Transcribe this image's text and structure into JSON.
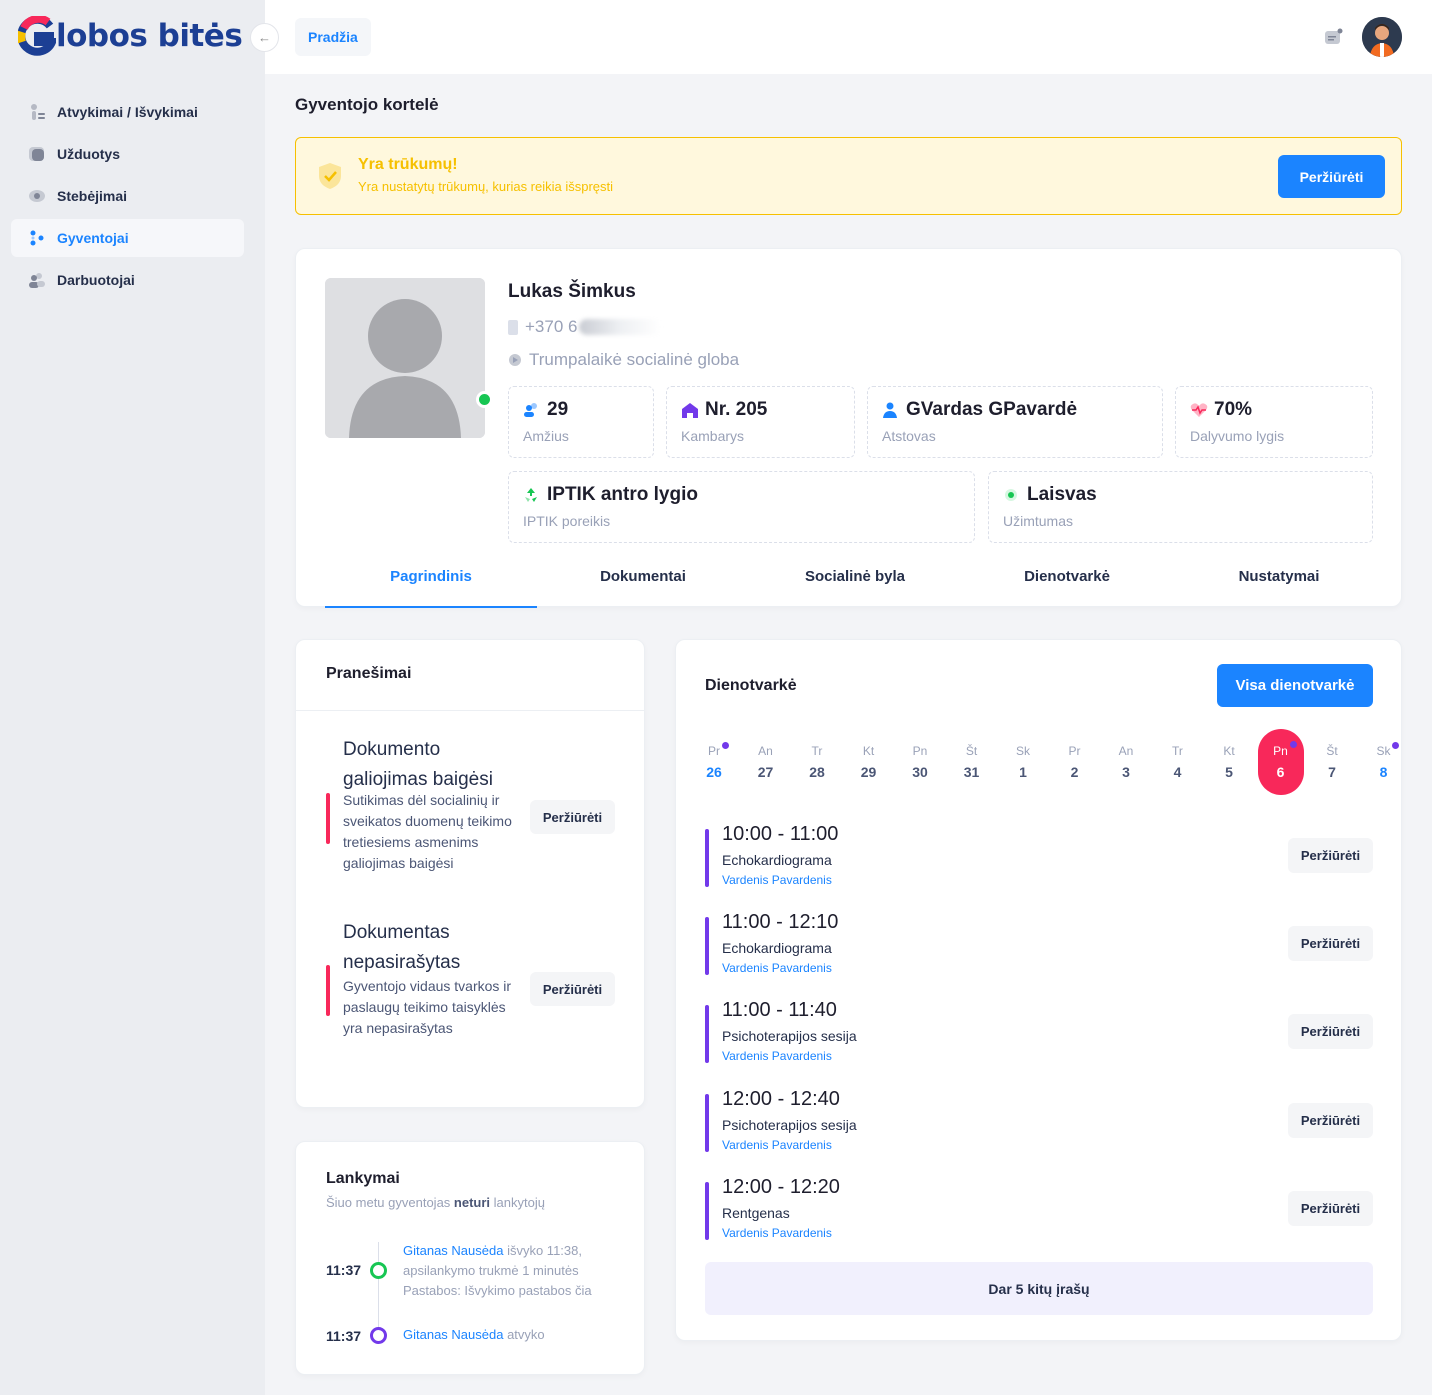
{
  "app": {
    "logo_text": "lobos bitės"
  },
  "sidebar": {
    "items": [
      {
        "label": "Atvykimai / Išvykimai",
        "icon": "person-arrows-icon"
      },
      {
        "label": "Užduotys",
        "icon": "tasks-icon"
      },
      {
        "label": "Stebėjimai",
        "icon": "eye-icon"
      },
      {
        "label": "Gyventojai",
        "icon": "residents-icon",
        "active": true
      },
      {
        "label": "Darbuotojai",
        "icon": "staff-icon"
      }
    ]
  },
  "topbar": {
    "breadcrumb": "Pradžia"
  },
  "page": {
    "title": "Gyventojo kortelė"
  },
  "alert": {
    "title": "Yra trūkumų!",
    "text": "Yra nustatytų trūkumų, kurias reikia išspręsti",
    "button": "Peržiūrėti"
  },
  "profile": {
    "name": "Lukas Šimkus",
    "phone": "+370 6",
    "care_type": "Trumpalaikė socialinė globa",
    "online": true,
    "stats": [
      {
        "value": "29",
        "label": "Amžius",
        "icon": "people-icon",
        "color": "#1b84ff"
      },
      {
        "value": "Nr. 205",
        "label": "Kambarys",
        "icon": "home-icon",
        "color": "#7239ea"
      },
      {
        "value": "GVardas GPavardė",
        "label": "Atstovas",
        "icon": "person-icon",
        "color": "#1b84ff"
      },
      {
        "value": "70%",
        "label": "Dalyvumo lygis",
        "icon": "heart-pulse-icon",
        "color": "#f8285a"
      },
      {
        "value": "IPTIK antro lygio",
        "label": "IPTIK poreikis",
        "icon": "recycle-icon",
        "color": "#17c653"
      },
      {
        "value": "Laisvas",
        "label": "Užimtumas",
        "icon": "status-dot-icon",
        "color": "#17c653"
      }
    ],
    "tabs": [
      "Pagrindinis",
      "Dokumentai",
      "Socialinė byla",
      "Dienotvarkė",
      "Nustatymai"
    ]
  },
  "notifications": {
    "title": "Pranešimai",
    "items": [
      {
        "title": "Dokumento galiojimas baigėsi",
        "text": "Sutikimas dėl socialinių ir sveikatos duomenų teikimo tretiesiems asmenims galiojimas baigėsi",
        "button": "Peržiūrėti"
      },
      {
        "title": "Dokumentas nepasirašytas",
        "text": "Gyventojo vidaus tvarkos ir paslaugų teikimo taisyklės yra nepasirašytas",
        "button": "Peržiūrėti"
      }
    ]
  },
  "visits": {
    "title": "Lankymai",
    "sub_prefix": "Šiuo metu gyventojas",
    "sub_bold": "neturi",
    "sub_suffix": "lankytojų",
    "items": [
      {
        "time": "11:37",
        "person": "Gitanas Nausėda",
        "text": "išvyko 11:38, apsilankymo trukmė 1 minutės",
        "note": "Pastabos: Išvykimo pastabos čia",
        "color": "#17c653"
      },
      {
        "time": "11:37",
        "person": "Gitanas Nausėda",
        "text": "atvyko",
        "note": "",
        "color": "#7239ea"
      }
    ]
  },
  "schedule": {
    "title": "Dienotvarkė",
    "button": "Visa dienotvarkė",
    "days": [
      {
        "name": "Pr",
        "num": "26",
        "blue": true,
        "dot": true
      },
      {
        "name": "An",
        "num": "27"
      },
      {
        "name": "Tr",
        "num": "28"
      },
      {
        "name": "Kt",
        "num": "29"
      },
      {
        "name": "Pn",
        "num": "30"
      },
      {
        "name": "Št",
        "num": "31"
      },
      {
        "name": "Sk",
        "num": "1"
      },
      {
        "name": "Pr",
        "num": "2"
      },
      {
        "name": "An",
        "num": "3"
      },
      {
        "name": "Tr",
        "num": "4"
      },
      {
        "name": "Kt",
        "num": "5"
      },
      {
        "name": "Pn",
        "num": "6",
        "selected": true,
        "dot": true
      },
      {
        "name": "Št",
        "num": "7"
      },
      {
        "name": "Sk",
        "num": "8",
        "blue": true,
        "dot": true
      }
    ],
    "events": [
      {
        "time": "10:00 - 11:00",
        "name": "Echokardiograma",
        "person": "Vardenis Pavardenis",
        "button": "Peržiūrėti"
      },
      {
        "time": "11:00 - 12:10",
        "name": "Echokardiograma",
        "person": "Vardenis Pavardenis",
        "button": "Peržiūrėti"
      },
      {
        "time": "11:00 - 11:40",
        "name": "Psichoterapijos sesija",
        "person": "Vardenis Pavardenis",
        "button": "Peržiūrėti"
      },
      {
        "time": "12:00 - 12:40",
        "name": "Psichoterapijos sesija",
        "person": "Vardenis Pavardenis",
        "button": "Peržiūrėti"
      },
      {
        "time": "12:00 - 12:20",
        "name": "Rentgenas",
        "person": "Vardenis Pavardenis",
        "button": "Peržiūrėti"
      }
    ],
    "more": "Dar 5 kitų įrašų"
  }
}
